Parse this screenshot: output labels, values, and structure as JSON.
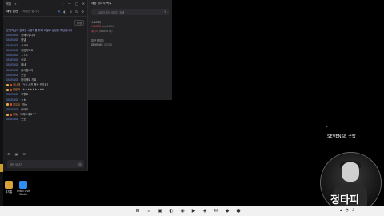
{
  "chat": {
    "title": "채팅",
    "search_glyph": "⌕",
    "tabs": [
      "채팅 옵션",
      "채팅창 숨기기",
      "채팅"
    ],
    "settings_label": "설정",
    "messages": [
      {
        "nick": "",
        "text": "운영자님이 참여한 시청자를 위해 비밀로 설정된 채팅입니다",
        "notice": true
      },
      {
        "nick": "SEVENSE",
        "text": "전해드립니다"
      },
      {
        "nick": "SEVENSE",
        "text": "넵넵"
      },
      {
        "nick": "SEVENSE",
        "text": "ㅋㅋㅋ"
      },
      {
        "nick": "SEVENSE",
        "text": "처음이에요"
      },
      {
        "nick": "SEVENSE",
        "text": "ㅅㅅㅅ"
      },
      {
        "nick": "SEVENSE",
        "text": "오오"
      },
      {
        "nick": "SEVENSE",
        "text": "네네"
      },
      {
        "nick": "SEVENSE",
        "text": "감사합니다"
      },
      {
        "nick": "SEVENSE",
        "text": "굿굿"
      },
      {
        "nick": "SEVENSE",
        "text": "다이렉트 가요"
      },
      {
        "nick": "강나래",
        "text": "ㅋㅋ 사진 찍는 건가요?",
        "badges": [
          "y",
          "r"
        ],
        "orange": true
      },
      {
        "nick": "방랑자",
        "text": "ㅎㅎㅎㅎㅎㅎㅎㅎㅎ",
        "badges": [
          "y",
          "r"
        ],
        "orange": true
      },
      {
        "nick": "SEVENSE",
        "text": "그렇죠"
      },
      {
        "nick": "SEVENSE",
        "text": "ㅎㅎ"
      },
      {
        "nick": "여우비",
        "text": "방송",
        "badges": [
          "y",
          "r"
        ],
        "orange": true
      },
      {
        "nick": "SEVENSE",
        "text": "좋아요"
      },
      {
        "nick": "하늘",
        "text": "그래주세요^^",
        "badges": [
          "y",
          "r"
        ],
        "orange": true
      },
      {
        "nick": "SEVENSE",
        "text": "굿굿"
      }
    ],
    "input_placeholder": "채팅 보내기",
    "send_glyph": "☺"
  },
  "panel": {
    "title": "채팅 참여자 목록",
    "search_placeholder": "닉네임 또는 아이디 검색",
    "section_manager": "스트리머",
    "managers": [
      {
        "name": "스트리머",
        "id": "(aaa1234)"
      },
      {
        "name": "매니저",
        "id": "(bbb5678)"
      }
    ],
    "section_viewers": "일반 참여자",
    "viewers": [
      {
        "name": "SEVENSE",
        "id": "(1234)"
      }
    ]
  },
  "streamer": {
    "ad_text": "SEVENSE 굿팝",
    "sign_text": "정타피"
  },
  "desktop": {
    "icons": [
      {
        "label": "휴지통",
        "color": "#d9a23a"
      },
      {
        "label": "Prism Live Studio",
        "color": "#2f8ff0"
      }
    ]
  },
  "taskbar": {
    "apps": [
      "⊞",
      "⌕",
      "▣",
      "◐",
      "◉",
      "▶",
      "◈",
      "✉",
      "◆",
      "●"
    ],
    "tray": [
      "▴",
      "◔",
      "♪"
    ]
  }
}
